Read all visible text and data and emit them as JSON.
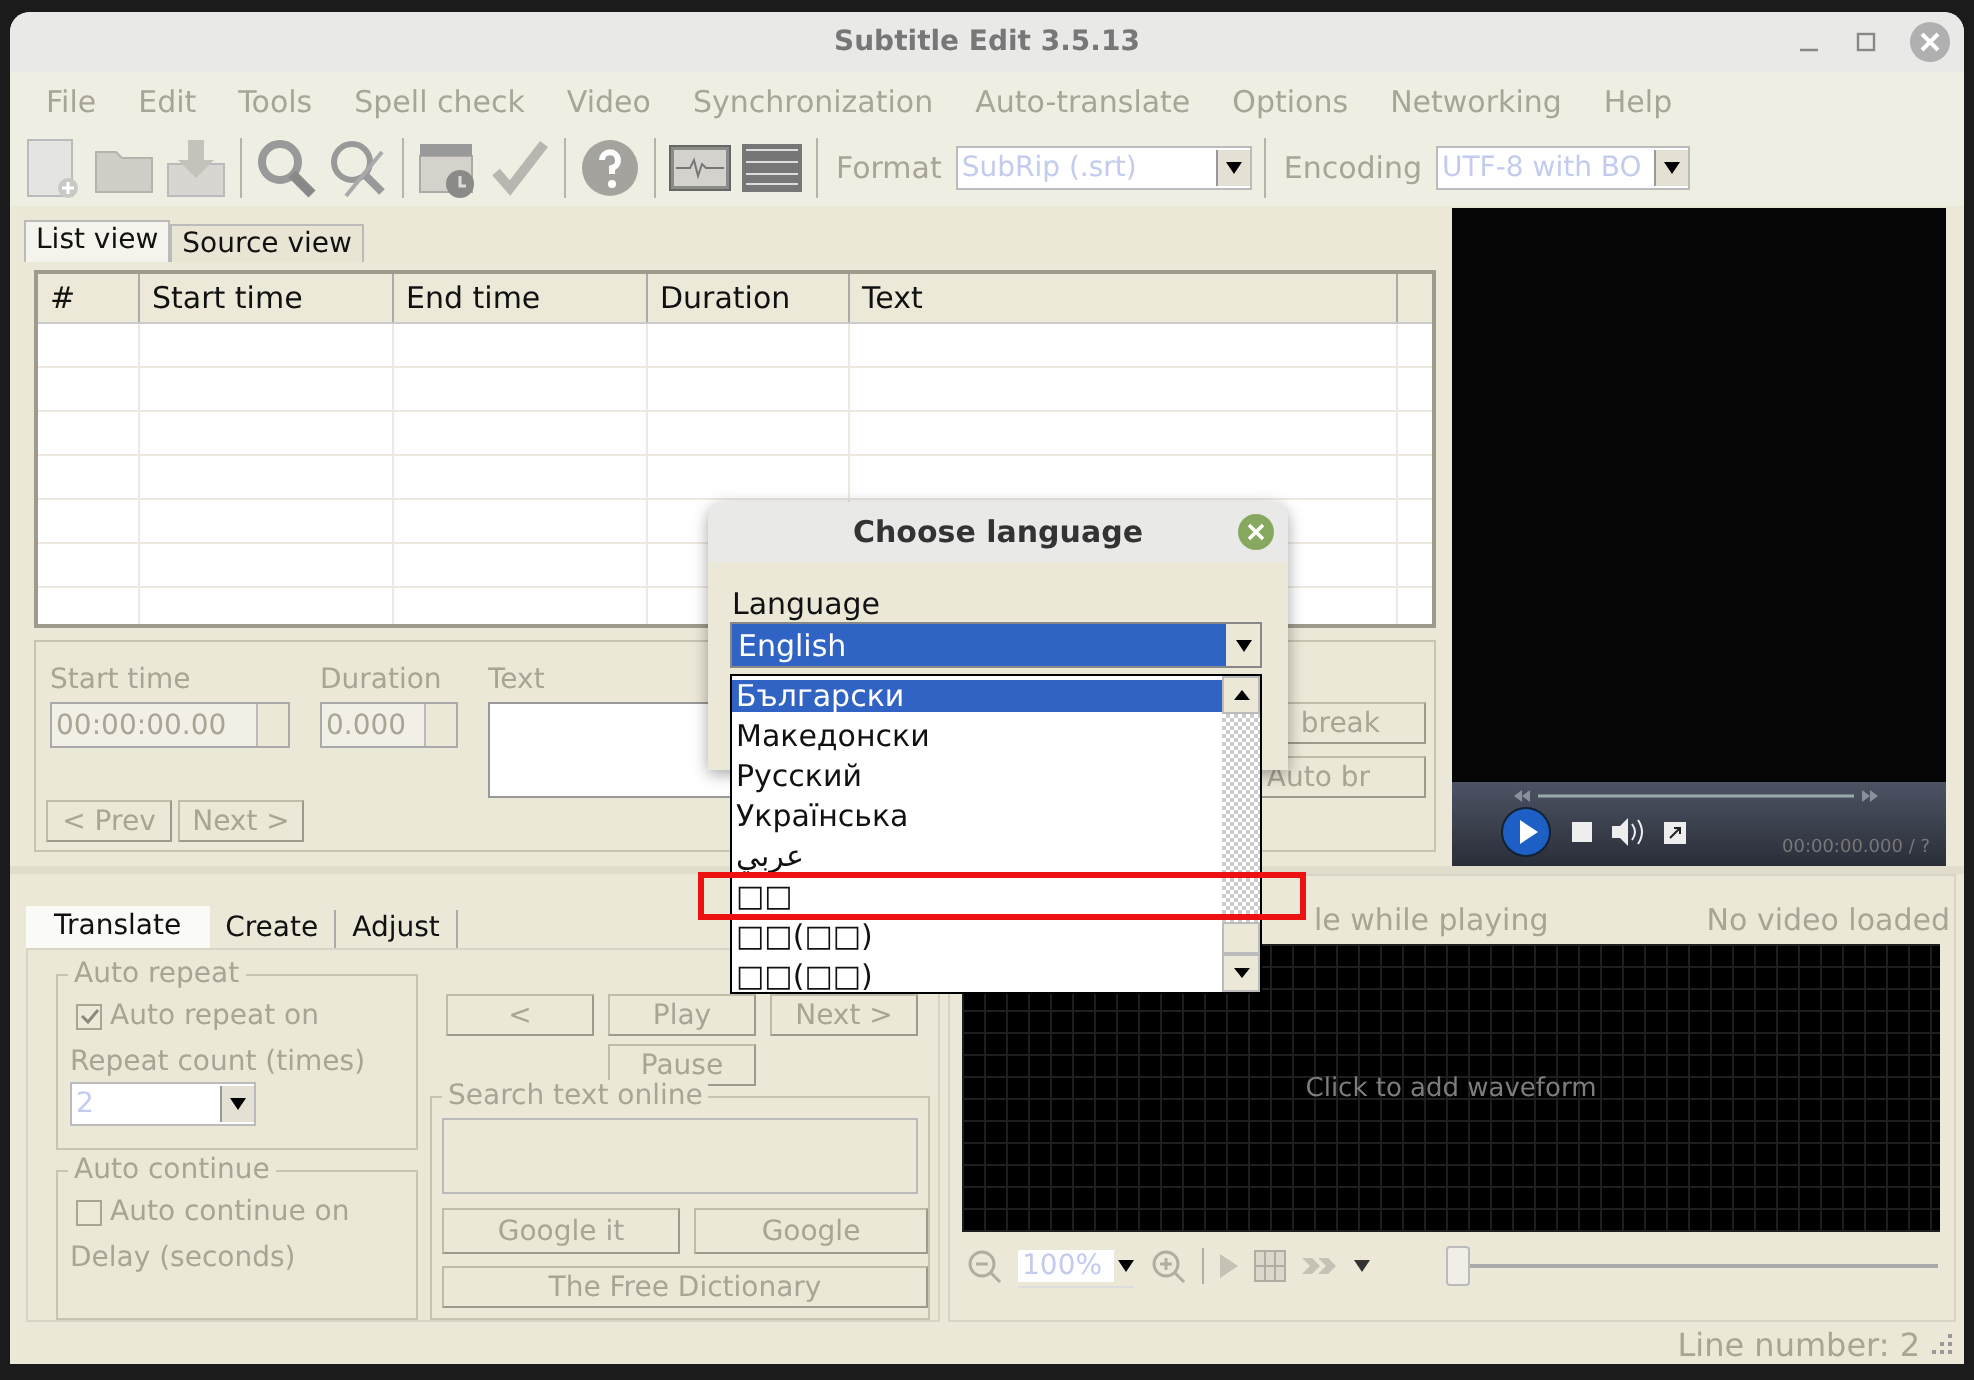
{
  "window": {
    "title": "Subtitle Edit 3.5.13"
  },
  "menu": [
    "File",
    "Edit",
    "Tools",
    "Spell check",
    "Video",
    "Synchronization",
    "Auto-translate",
    "Options",
    "Networking",
    "Help"
  ],
  "toolbar": {
    "format": {
      "label": "Format",
      "value": "SubRip (.srt)"
    },
    "encoding": {
      "label": "Encoding",
      "value": "UTF-8 with BO"
    }
  },
  "view_tabs": [
    {
      "label": "List view",
      "selected": true
    },
    {
      "label": "Source view",
      "selected": false
    }
  ],
  "table": {
    "columns": [
      "#",
      "Start time",
      "End time",
      "Duration",
      "Text"
    ]
  },
  "editor": {
    "start_time": {
      "label": "Start time",
      "value": "00:00:00.00"
    },
    "duration": {
      "label": "Duration",
      "value": "0.000"
    },
    "text_label": "Text",
    "nav_buttons": [
      "< Prev",
      "Next >"
    ],
    "side_buttons": [
      "break",
      "Auto br"
    ]
  },
  "video_player": {
    "time": "00:00:00.000 / ?"
  },
  "tool_tabs": [
    {
      "label": "Translate",
      "selected": true
    },
    {
      "label": "Create",
      "selected": false
    },
    {
      "label": "Adjust",
      "selected": false
    }
  ],
  "auto_repeat": {
    "title": "Auto repeat",
    "checkbox": {
      "label": "Auto repeat on",
      "checked": true
    },
    "count_label": "Repeat count (times)",
    "count_value": "2"
  },
  "auto_continue": {
    "title": "Auto continue",
    "checkbox": {
      "label": "Auto continue on",
      "checked": false
    },
    "delay_label": "Delay (seconds)"
  },
  "playback_buttons": [
    "<",
    "Play",
    "Next >",
    "Pause"
  ],
  "search_online": {
    "title": "Search text online",
    "buttons": [
      "Google it",
      "Google",
      "The Free Dictionary"
    ]
  },
  "waveform": {
    "follow_label": "le while playing",
    "video_status": "No video loaded",
    "hint": "Click to add waveform",
    "zoom": "100%",
    "position": {
      "level": 0
    }
  },
  "status_bar": {
    "line_number": "Line number: 2"
  },
  "dialog": {
    "title": "Choose language",
    "field_label": "Language",
    "value": "English",
    "options": [
      {
        "label": "Български",
        "selected": true
      },
      {
        "label": "Македонски",
        "selected": false
      },
      {
        "label": "Русский",
        "selected": false
      },
      {
        "label": "Українська",
        "selected": false
      },
      {
        "label": "عربي",
        "selected": false
      },
      {
        "label": "□□",
        "selected": false
      },
      {
        "label": "□□(□□)",
        "selected": false
      },
      {
        "label": "□□(□□)",
        "selected": false
      }
    ]
  }
}
